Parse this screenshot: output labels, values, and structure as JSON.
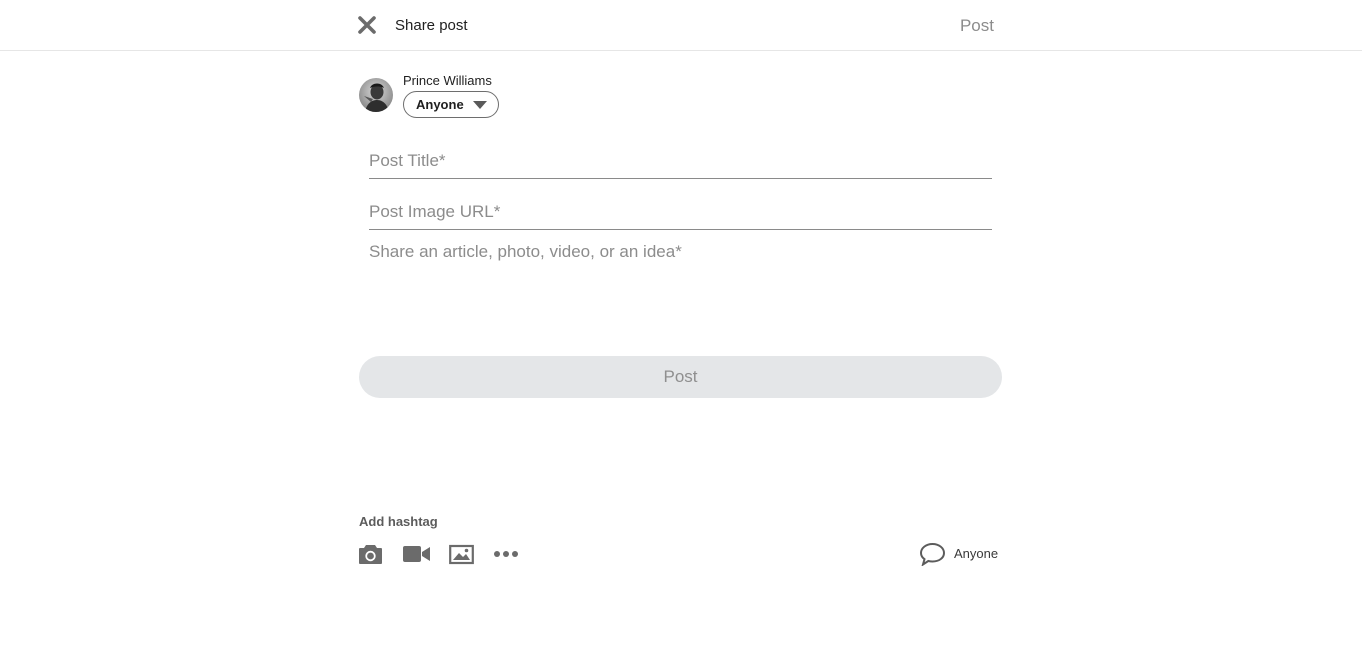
{
  "header": {
    "title": "Share post",
    "post_label": "Post"
  },
  "author": {
    "name": "Prince Williams",
    "visibility": "Anyone"
  },
  "form": {
    "title_placeholder": "Post Title*",
    "image_url_placeholder": "Post Image URL*",
    "body_placeholder": "Share an article, photo, video, or an idea*",
    "post_button_label": "Post"
  },
  "footer": {
    "hashtag_label": "Add hashtag",
    "tools": [
      "camera-icon",
      "video-icon",
      "image-icon",
      "more-icon"
    ],
    "comment_visibility": "Anyone"
  },
  "colors": {
    "icon_gray": "#6b6b6b",
    "post_button_bg": "#e4e6e8",
    "muted_text": "#8c8c8c"
  }
}
